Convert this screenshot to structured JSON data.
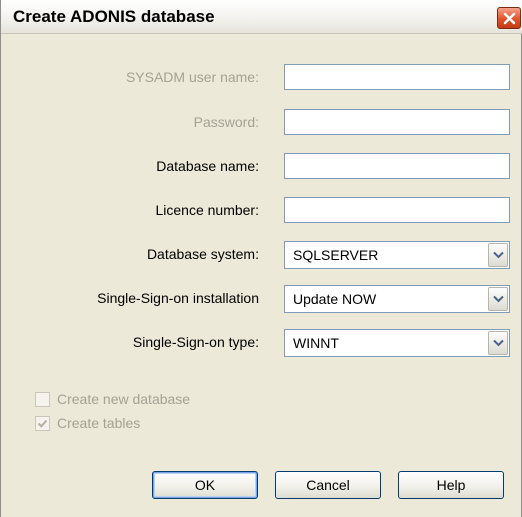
{
  "dialog": {
    "title": "Create ADONIS database"
  },
  "form": {
    "sysadm_label": "SYSADM user name:",
    "sysadm_value": "",
    "password_label": "Password:",
    "password_value": "",
    "dbname_label": "Database name:",
    "dbname_value": "",
    "licence_label": "Licence number:",
    "licence_value": "",
    "dbsystem_label": "Database system:",
    "dbsystem_value": "SQLSERVER",
    "sso_install_label": "Single-Sign-on installation",
    "sso_install_value": "Update NOW",
    "sso_type_label": "Single-Sign-on type:",
    "sso_type_value": "WINNT"
  },
  "options": {
    "create_db_label": "Create new database",
    "create_db_checked": false,
    "create_tables_label": "Create tables",
    "create_tables_checked": true
  },
  "buttons": {
    "ok": "OK",
    "cancel": "Cancel",
    "help": "Help"
  }
}
